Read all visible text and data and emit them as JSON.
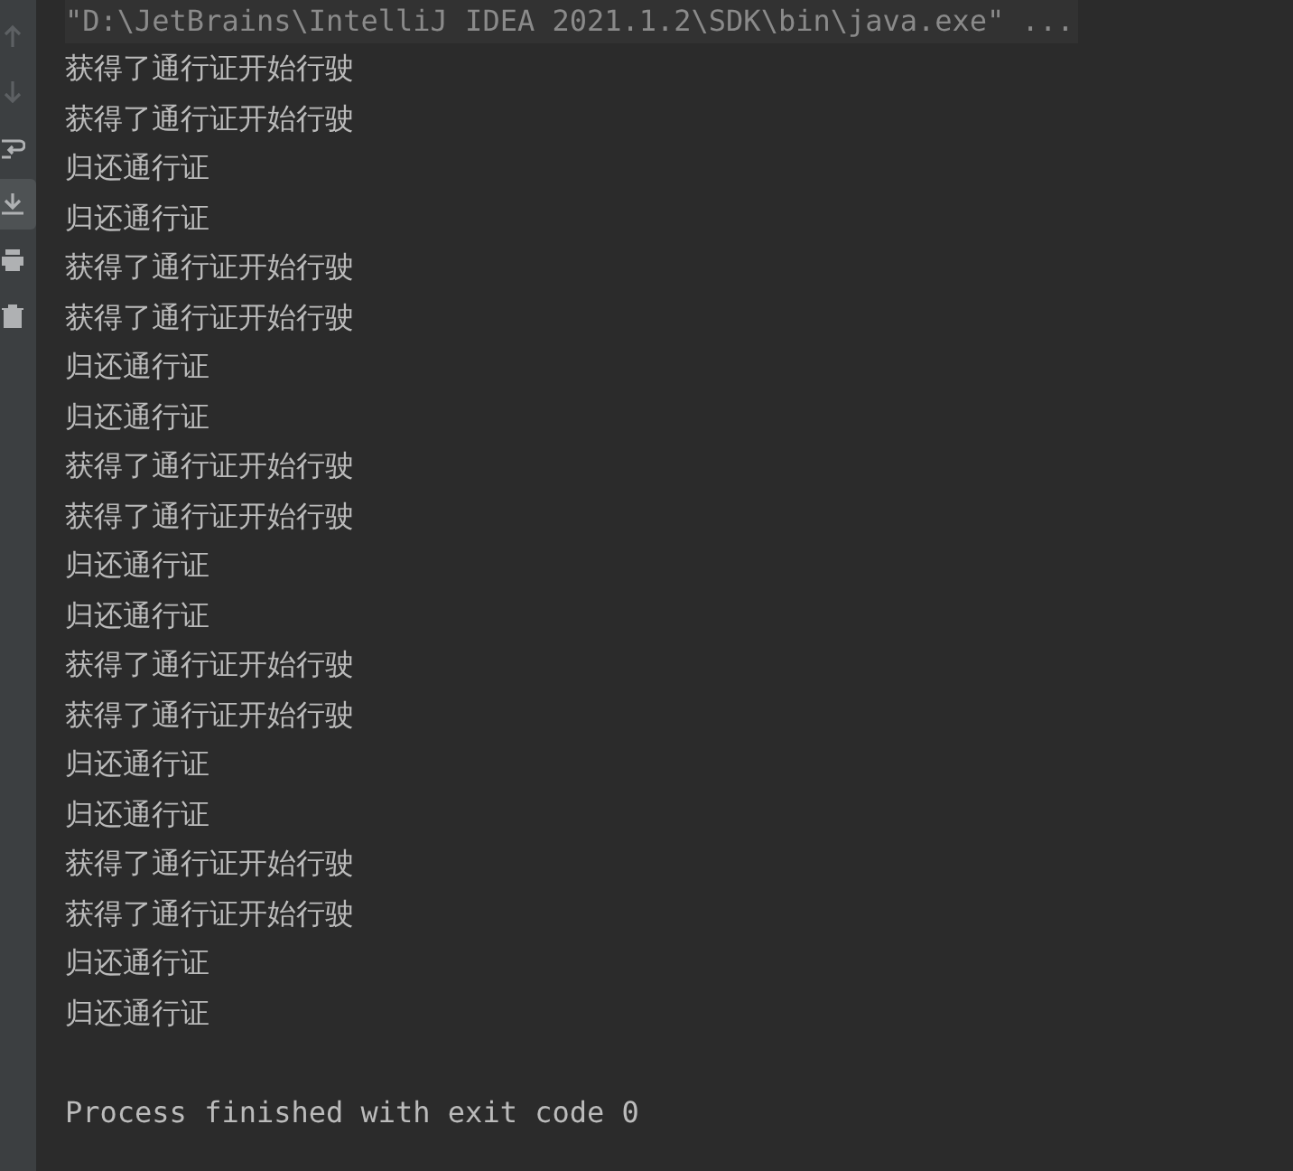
{
  "toolbar": [
    {
      "kind": "up",
      "disabled": true,
      "selected": false
    },
    {
      "kind": "down",
      "disabled": true,
      "selected": false
    },
    {
      "kind": "wrap",
      "disabled": false,
      "selected": false
    },
    {
      "kind": "scroll-end",
      "disabled": false,
      "selected": true
    },
    {
      "kind": "print",
      "disabled": false,
      "selected": false
    },
    {
      "kind": "trash",
      "disabled": false,
      "selected": false
    }
  ],
  "console": {
    "command": "\"D:\\JetBrains\\IntelliJ IDEA 2021.1.2\\SDK\\bin\\java.exe\" ...",
    "lines": [
      "获得了通行证开始行驶",
      "获得了通行证开始行驶",
      "归还通行证",
      "归还通行证",
      "获得了通行证开始行驶",
      "获得了通行证开始行驶",
      "归还通行证",
      "归还通行证",
      "获得了通行证开始行驶",
      "获得了通行证开始行驶",
      "归还通行证",
      "归还通行证",
      "获得了通行证开始行驶",
      "获得了通行证开始行驶",
      "归还通行证",
      "归还通行证",
      "获得了通行证开始行驶",
      "获得了通行证开始行驶",
      "归还通行证",
      "归还通行证"
    ],
    "exit_message": "Process finished with exit code 0"
  }
}
